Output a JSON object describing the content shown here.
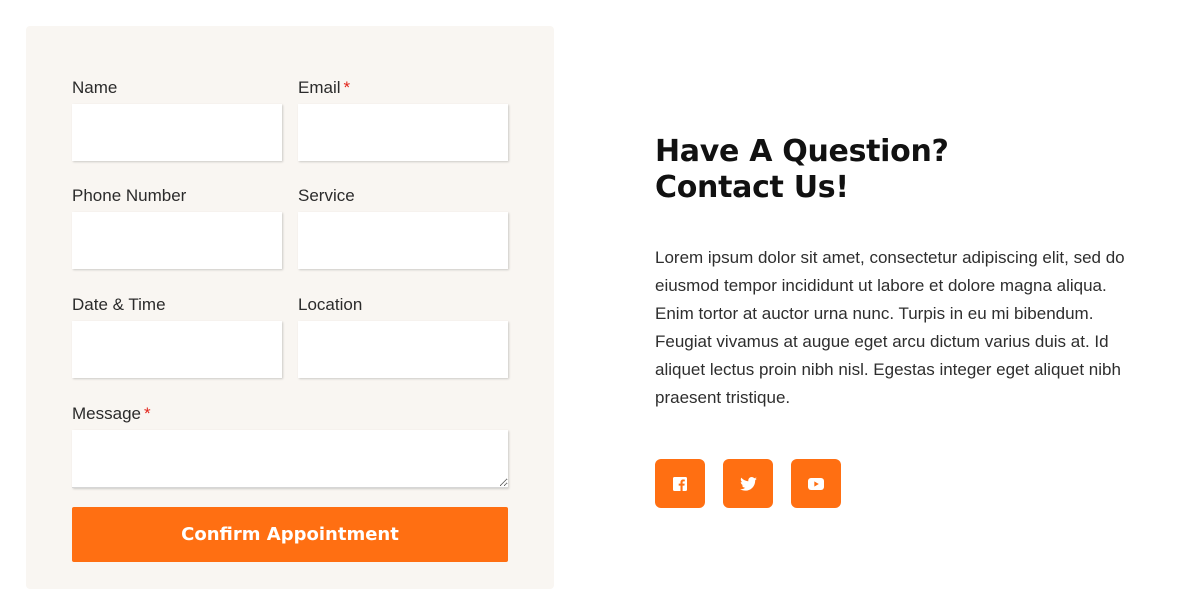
{
  "form": {
    "fields": [
      {
        "label": "Name",
        "required": false,
        "value": ""
      },
      {
        "label": "Email",
        "required": true,
        "value": ""
      },
      {
        "label": "Phone Number",
        "required": false,
        "value": ""
      },
      {
        "label": "Service",
        "required": false,
        "value": ""
      },
      {
        "label": "Date & Time",
        "required": false,
        "value": ""
      },
      {
        "label": "Location",
        "required": false,
        "value": ""
      }
    ],
    "message": {
      "label": "Message",
      "required": true,
      "value": ""
    },
    "required_marker": "*",
    "submit_label": "Confirm Appointment"
  },
  "info": {
    "heading_line1": "Have A Question?",
    "heading_line2": "Contact Us!",
    "description": "Lorem ipsum dolor sit amet, consectetur adipiscing elit, sed do eiusmod tempor incididunt ut labore et dolore magna aliqua. Enim tortor at auctor urna nunc. Turpis in eu mi bibendum. Feugiat vivamus at augue eget arcu dictum varius duis at. Id aliquet lectus proin nibh nisl. Egestas integer eget aliquet nibh praesent tristique."
  },
  "social": {
    "icons": [
      "facebook-icon",
      "twitter-icon",
      "youtube-icon"
    ]
  },
  "colors": {
    "accent": "#ff6f12",
    "form_background": "#f9f6f2",
    "required": "#e2231a",
    "heading": "#111111"
  }
}
